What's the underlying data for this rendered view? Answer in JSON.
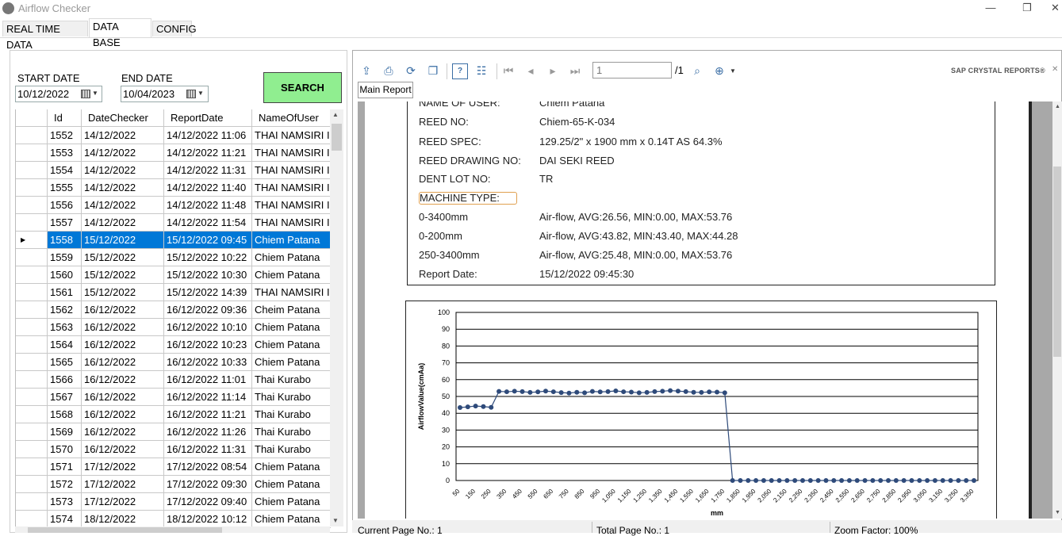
{
  "window": {
    "title": "Airflow Checker",
    "minimize": "—",
    "restore": "❐",
    "close": "✕"
  },
  "tabs": [
    "REAL TIME DATA",
    "DATA BASE",
    "CONFIG"
  ],
  "filters": {
    "start_label": "START DATE",
    "start_value": "10/12/2022",
    "end_label": "END DATE",
    "end_value": "10/04/2023",
    "search_label": "SEARCH"
  },
  "grid": {
    "headers": [
      "Id",
      "DateChecker",
      "ReportDate",
      "NameOfUser"
    ],
    "rows": [
      [
        "1552",
        "14/12/2022",
        "14/12/2022 11:06",
        "THAI NAMSIRI IN"
      ],
      [
        "1553",
        "14/12/2022",
        "14/12/2022 11:21",
        "THAI NAMSIRI IN"
      ],
      [
        "1554",
        "14/12/2022",
        "14/12/2022 11:31",
        "THAI NAMSIRI IN"
      ],
      [
        "1555",
        "14/12/2022",
        "14/12/2022 11:40",
        "THAI NAMSIRI IN"
      ],
      [
        "1556",
        "14/12/2022",
        "14/12/2022 11:48",
        "THAI NAMSIRI IN"
      ],
      [
        "1557",
        "14/12/2022",
        "14/12/2022 11:54",
        "THAI NAMSIRI IN"
      ],
      [
        "1558",
        "15/12/2022",
        "15/12/2022 09:45",
        "Chiem Patana"
      ],
      [
        "1559",
        "15/12/2022",
        "15/12/2022 10:22",
        "Chiem Patana"
      ],
      [
        "1560",
        "15/12/2022",
        "15/12/2022 10:30",
        "Chiem Patana"
      ],
      [
        "1561",
        "15/12/2022",
        "15/12/2022 14:39",
        "THAI NAMSIRI IN"
      ],
      [
        "1562",
        "16/12/2022",
        "16/12/2022 09:36",
        "Cheim Patana"
      ],
      [
        "1563",
        "16/12/2022",
        "16/12/2022 10:10",
        "Chiem Patana"
      ],
      [
        "1564",
        "16/12/2022",
        "16/12/2022 10:23",
        "Chiem Patana"
      ],
      [
        "1565",
        "16/12/2022",
        "16/12/2022 10:33",
        "Chiem Patana"
      ],
      [
        "1566",
        "16/12/2022",
        "16/12/2022 11:01",
        "Thai Kurabo"
      ],
      [
        "1567",
        "16/12/2022",
        "16/12/2022 11:14",
        "Thai Kurabo"
      ],
      [
        "1568",
        "16/12/2022",
        "16/12/2022 11:21",
        "Thai Kurabo"
      ],
      [
        "1569",
        "16/12/2022",
        "16/12/2022 11:26",
        "Thai Kurabo"
      ],
      [
        "1570",
        "16/12/2022",
        "16/12/2022 11:31",
        "Thai Kurabo"
      ],
      [
        "1571",
        "17/12/2022",
        "17/12/2022 08:54",
        "Chiem Patana"
      ],
      [
        "1572",
        "17/12/2022",
        "17/12/2022 09:30",
        "Chiem Patana"
      ],
      [
        "1573",
        "17/12/2022",
        "17/12/2022 09:40",
        "Chiem Patana"
      ],
      [
        "1574",
        "18/12/2022",
        "18/12/2022 10:12",
        "Chiem Patana"
      ]
    ],
    "selected_index": 6,
    "row_marker": "▶"
  },
  "viewer": {
    "page_value": "1",
    "page_total": "/1",
    "brand": "SAP CRYSTAL REPORTS®",
    "close": "✕",
    "tab_label": "Main Report",
    "status": {
      "current": "Current Page No.: 1",
      "total": "Total Page No.: 1",
      "zoom": "Zoom Factor: 100%"
    }
  },
  "report": {
    "fields": [
      {
        "label": "NAME OF USER:",
        "value": "Chiem Patana"
      },
      {
        "label": "REED NO:",
        "value": "Chiem-65-K-034"
      },
      {
        "label": "REED SPEC:",
        "value": "129.25/2\" x 1900 mm x 0.14T AS 64.3%"
      },
      {
        "label": "REED DRAWING NO:",
        "value": "DAI SEKI REED"
      },
      {
        "label": "DENT LOT NO:",
        "value": "TR"
      },
      {
        "label": "MACHINE TYPE:",
        "value": ""
      },
      {
        "label": "0-3400mm",
        "value": "Air-flow, AVG:26.56, MIN:0.00, MAX:53.76"
      },
      {
        "label": "0-200mm",
        "value": "Air-flow, AVG:43.82, MIN:43.40, MAX:44.28"
      },
      {
        "label": "250-3400mm",
        "value": "Air-flow, AVG:25.48, MIN:0.00, MAX:53.76"
      },
      {
        "label": "Report Date:",
        "value": "15/12/2022  09:45:30"
      }
    ]
  },
  "chart_data": {
    "type": "line",
    "title": "",
    "xlabel": "mm",
    "ylabel": "AirflowValue(cmAa)",
    "ylim": [
      0,
      100
    ],
    "yticks": [
      0,
      10,
      20,
      30,
      40,
      50,
      60,
      70,
      80,
      90,
      100
    ],
    "x": [
      50,
      100,
      150,
      200,
      250,
      300,
      350,
      400,
      450,
      500,
      550,
      600,
      650,
      700,
      750,
      800,
      850,
      900,
      950,
      1000,
      1050,
      1100,
      1150,
      1200,
      1250,
      1300,
      1350,
      1400,
      1450,
      1500,
      1550,
      1600,
      1650,
      1700,
      1750,
      1800,
      1850,
      1900,
      1950,
      2000,
      2050,
      2100,
      2150,
      2200,
      2250,
      2300,
      2350,
      2400,
      2450,
      2500,
      2550,
      2600,
      2650,
      2700,
      2750,
      2800,
      2850,
      2900,
      2950,
      3000,
      3050,
      3100,
      3150,
      3200,
      3250,
      3300,
      3350
    ],
    "xtick_labels": [
      "50",
      "150",
      "250",
      "350",
      "450",
      "550",
      "650",
      "750",
      "850",
      "950",
      "1,050",
      "1,150",
      "1,250",
      "1,350",
      "1,450",
      "1,550",
      "1,650",
      "1,750",
      "1,850",
      "1,950",
      "2,050",
      "2,150",
      "2,250",
      "2,350",
      "2,450",
      "2,550",
      "2,650",
      "2,750",
      "2,850",
      "2,950",
      "3,050",
      "3,150",
      "3,250",
      "3,350"
    ],
    "series": [
      {
        "values": [
          43.4,
          43.8,
          44.3,
          44.0,
          43.5,
          53.0,
          52.8,
          53.1,
          52.9,
          52.4,
          52.7,
          53.2,
          52.8,
          52.3,
          52.0,
          52.5,
          52.2,
          53.0,
          52.7,
          52.9,
          53.3,
          52.8,
          52.6,
          52.2,
          52.4,
          52.9,
          53.1,
          53.5,
          53.2,
          52.9,
          52.5,
          52.4,
          52.7,
          52.6,
          52.2,
          0,
          0,
          0,
          0,
          0,
          0,
          0,
          0,
          0,
          0,
          0,
          0,
          0,
          0,
          0,
          0,
          0,
          0,
          0,
          0,
          0,
          0,
          0,
          0,
          0,
          0,
          0,
          0,
          0,
          0,
          0,
          0
        ],
        "color": "#2e4a7a"
      }
    ],
    "grid": true,
    "legend": "none"
  }
}
